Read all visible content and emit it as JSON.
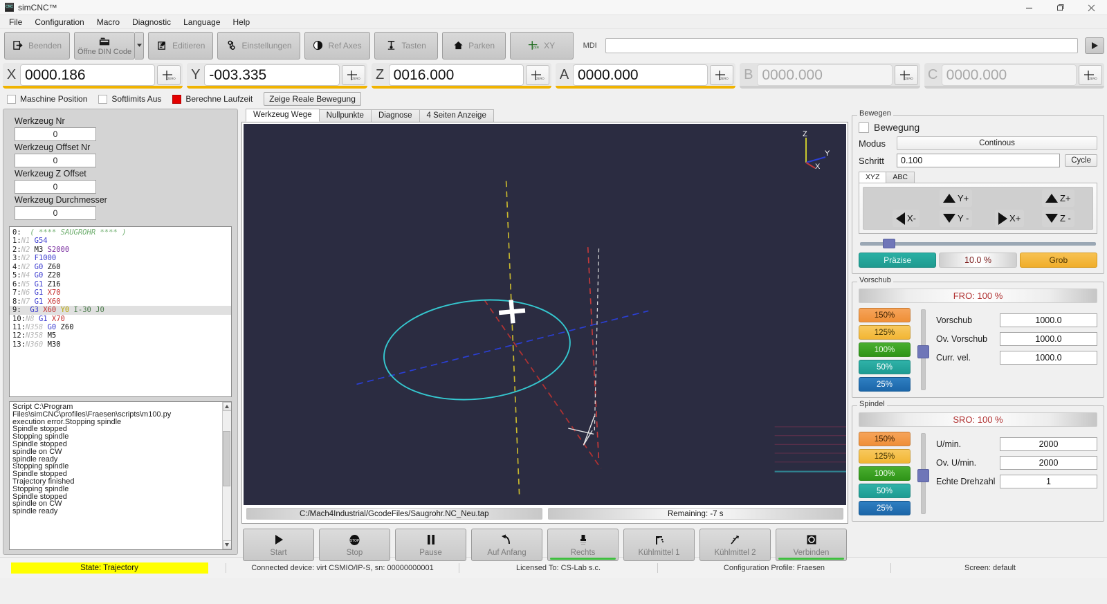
{
  "window": {
    "title": "simCNC™",
    "minimize": "–",
    "maximize": "❐",
    "close": "✕"
  },
  "menu": [
    "File",
    "Configuration",
    "Macro",
    "Diagnostic",
    "Language",
    "Help"
  ],
  "toolbar": {
    "buttons": [
      {
        "label": "Beenden",
        "icon": "exit-icon"
      },
      {
        "label": "Öffne DIN Code",
        "icon": "open-file-icon"
      },
      {
        "label": "Editieren",
        "icon": "edit-icon"
      },
      {
        "label": "Einstellungen",
        "icon": "settings-icon"
      },
      {
        "label": "Ref Axes",
        "icon": "ref-axes-icon"
      },
      {
        "label": "Tasten",
        "icon": "probe-icon"
      },
      {
        "label": "Parken",
        "icon": "home-icon"
      },
      {
        "label": "XY",
        "icon": "zero-xy-icon"
      }
    ],
    "mdi_label": "MDI",
    "mdi_value": "",
    "mdi_placeholder": "",
    "run_icon": "play-icon"
  },
  "dro": {
    "axes": [
      {
        "axis": "X",
        "value": "0000.186",
        "enabled": true
      },
      {
        "axis": "Y",
        "value": "-003.335",
        "enabled": true
      },
      {
        "axis": "Z",
        "value": "0016.000",
        "enabled": true
      },
      {
        "axis": "A",
        "value": "0000.000",
        "enabled": true
      },
      {
        "axis": "B",
        "value": "0000.000",
        "enabled": false
      },
      {
        "axis": "C",
        "value": "0000.000",
        "enabled": false
      }
    ],
    "zero_button_label": "ZERO"
  },
  "options": {
    "machine_position": "Maschine Position",
    "softlimits": "Softlimits Aus",
    "calc_runtime": "Berechne Laufzeit",
    "show_real_motion": "Zeige Reale Bewegung",
    "calc_runtime_color": "#e40000"
  },
  "tool": {
    "fields": [
      {
        "label": "Werkzeug Nr",
        "value": "0"
      },
      {
        "label": "Werkzeug Offset Nr",
        "value": "0"
      },
      {
        "label": "Werkzeug Z Offset",
        "value": "0"
      },
      {
        "label": "Werkzeug Durchmesser",
        "value": "0"
      }
    ]
  },
  "gcode": {
    "active_line": 9,
    "lines": [
      {
        "n": "0:",
        "nn": "",
        "tokens": [
          {
            "t": "( **** SAUGROHR **** )",
            "c": "c"
          }
        ]
      },
      {
        "n": "1:",
        "nn": "N1",
        "tokens": [
          {
            "t": "G54",
            "c": "g"
          }
        ]
      },
      {
        "n": "2:",
        "nn": "N2",
        "tokens": [
          {
            "t": "M3 ",
            "c": "m"
          },
          {
            "t": "S2000",
            "c": "s"
          }
        ]
      },
      {
        "n": "3:",
        "nn": "N2",
        "tokens": [
          {
            "t": "F1000",
            "c": "g"
          }
        ]
      },
      {
        "n": "4:",
        "nn": "N2",
        "tokens": [
          {
            "t": "G0 ",
            "c": "g"
          },
          {
            "t": "Z60",
            "c": "m"
          }
        ]
      },
      {
        "n": "5:",
        "nn": "N4",
        "tokens": [
          {
            "t": "G0 ",
            "c": "g"
          },
          {
            "t": "Z20",
            "c": "m"
          }
        ]
      },
      {
        "n": "6:",
        "nn": "N5",
        "tokens": [
          {
            "t": "G1 ",
            "c": "g"
          },
          {
            "t": "Z16",
            "c": "m"
          }
        ]
      },
      {
        "n": "7:",
        "nn": "N6",
        "tokens": [
          {
            "t": "G1 ",
            "c": "g"
          },
          {
            "t": "X70",
            "c": "x"
          }
        ]
      },
      {
        "n": "8:",
        "nn": "N7",
        "tokens": [
          {
            "t": "G1 ",
            "c": "g"
          },
          {
            "t": "X60",
            "c": "x"
          }
        ]
      },
      {
        "n": "9:",
        "nn": "",
        "tokens": [
          {
            "t": "G3 ",
            "c": "g"
          },
          {
            "t": "X60 ",
            "c": "x"
          },
          {
            "t": "Y0 ",
            "c": "y"
          },
          {
            "t": "I-30 J0",
            "c": "i"
          }
        ]
      },
      {
        "n": "10:",
        "nn": "N8",
        "tokens": [
          {
            "t": "G1 ",
            "c": "g"
          },
          {
            "t": "X70",
            "c": "x"
          }
        ]
      },
      {
        "n": "11:",
        "nn": "N358",
        "tokens": [
          {
            "t": "G0 ",
            "c": "g"
          },
          {
            "t": "Z60",
            "c": "m"
          }
        ]
      },
      {
        "n": "12:",
        "nn": "N358",
        "tokens": [
          {
            "t": "M5",
            "c": "m"
          }
        ]
      },
      {
        "n": "13:",
        "nn": "N360",
        "tokens": [
          {
            "t": "M30",
            "c": "m"
          }
        ]
      }
    ]
  },
  "log": {
    "lines": [
      "Script C:\\Program Files\\simCNC\\profiles\\Fraesen\\scripts\\m100.py",
      "execution error.Stopping spindle",
      "Spindle stopped",
      "Stopping spindle",
      "Spindle stopped",
      "spindle on CW",
      "spindle ready",
      "Stopping spindle",
      "Spindle stopped",
      "Trajectory finished",
      "Stopping spindle",
      "Spindle stopped",
      "spindle on CW",
      "spindle ready"
    ],
    "scroll_up": "▲",
    "scroll_down": "▼"
  },
  "viewer": {
    "tabs": [
      {
        "label": "Werkzeug Wege",
        "active": true
      },
      {
        "label": "Nullpunkte",
        "active": false
      },
      {
        "label": "Diagnose",
        "active": false
      },
      {
        "label": "4 Seiten Anzeige",
        "active": false
      }
    ],
    "axis_gizmo": {
      "x": "X",
      "y": "Y",
      "z": "Z"
    },
    "file_path": "C:/Mach4Industrial/GcodeFiles/Saugrohr.NC_Neu.tap",
    "remaining": "Remaining: -7 s",
    "background_color": "#2b2c41",
    "toolpath_color": "#35c8d0"
  },
  "control_buttons": [
    {
      "label": "Start",
      "icon": "play-icon",
      "green_bar": false
    },
    {
      "label": "Stop",
      "icon": "stop-icon",
      "green_bar": false
    },
    {
      "label": "Pause",
      "icon": "pause-icon",
      "green_bar": false
    },
    {
      "label": "Auf Anfang",
      "icon": "rewind-icon",
      "green_bar": false
    },
    {
      "label": "Rechts",
      "icon": "spindle-cw-icon",
      "green_bar": true
    },
    {
      "label": "Kühlmittel 1",
      "icon": "coolant-icon",
      "green_bar": false
    },
    {
      "label": "Kühlmittel 2",
      "icon": "mist-icon",
      "green_bar": false
    },
    {
      "label": "Verbinden",
      "icon": "connect-icon",
      "green_bar": true
    }
  ],
  "jog": {
    "group_title": "Bewegen",
    "enable_label": "Bewegung",
    "mode_label": "Modus",
    "mode_value": "Continous",
    "step_label": "Schritt",
    "step_value": "0.100",
    "cycle_label": "Cycle",
    "tabs": [
      {
        "label": "XYZ",
        "active": true
      },
      {
        "label": "ABC",
        "active": false
      }
    ],
    "buttons": [
      {
        "label": "Y+",
        "dir": "up"
      },
      {
        "label": "Z+",
        "dir": "up"
      },
      {
        "label": "X-",
        "dir": "left"
      },
      {
        "label": "Y -",
        "dir": "down"
      },
      {
        "label": "X+",
        "dir": "right"
      },
      {
        "label": "Z -",
        "dir": "down"
      }
    ],
    "precise_label": "Präzise",
    "percent_value": "10.0 %",
    "coarse_label": "Grob",
    "precise_color": "#229b92",
    "coarse_color": "#f0ae2a"
  },
  "feed": {
    "group_title": "Vorschub",
    "header": "FRO: 100 %",
    "presets": [
      "150%",
      "125%",
      "100%",
      "50%",
      "25%"
    ],
    "fields": [
      {
        "label": "Vorschub",
        "value": "1000.0"
      },
      {
        "label": "Ov. Vorschub",
        "value": "1000.0"
      },
      {
        "label": "Curr. vel.",
        "value": "1000.0"
      }
    ]
  },
  "spindle": {
    "group_title": "Spindel",
    "header": "SRO: 100 %",
    "presets": [
      "150%",
      "125%",
      "100%",
      "50%",
      "25%"
    ],
    "fields": [
      {
        "label": "U/min.",
        "value": "2000"
      },
      {
        "label": "Ov. U/min.",
        "value": "2000"
      },
      {
        "label": "Echte Drehzahl",
        "value": "1"
      }
    ]
  },
  "statusbar": {
    "state": "State: Trajectory",
    "state_color": "#ffff00",
    "device": "Connected device: virt CSMIO/IP-S, sn: 00000000001",
    "license": "Licensed To: CS-Lab s.c.",
    "profile": "Configuration Profile: Fraesen",
    "screen": "Screen: default"
  }
}
